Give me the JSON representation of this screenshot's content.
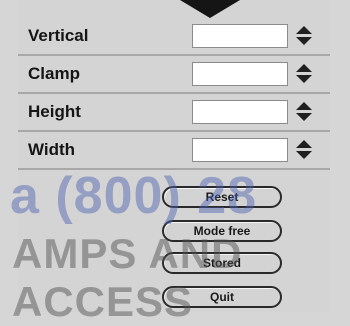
{
  "fields": [
    {
      "label": "Vertical",
      "value": ""
    },
    {
      "label": "Clamp",
      "value": ""
    },
    {
      "label": "Height",
      "value": ""
    },
    {
      "label": "Width",
      "value": ""
    }
  ],
  "buttons": [
    "Reset",
    "Mode free",
    "Stored",
    "Quit"
  ],
  "watermark": {
    "line1": "a (800) 28",
    "line2": "AMPS AND ACCESS"
  },
  "colors": {
    "panel_bg": "#d4d4d4",
    "input_bg": "#ffffff",
    "watermark_blue": "#4a5eaf",
    "watermark_gray": "#525252"
  },
  "icons": [
    "arrow-down-icon",
    "spinner-icon"
  ]
}
